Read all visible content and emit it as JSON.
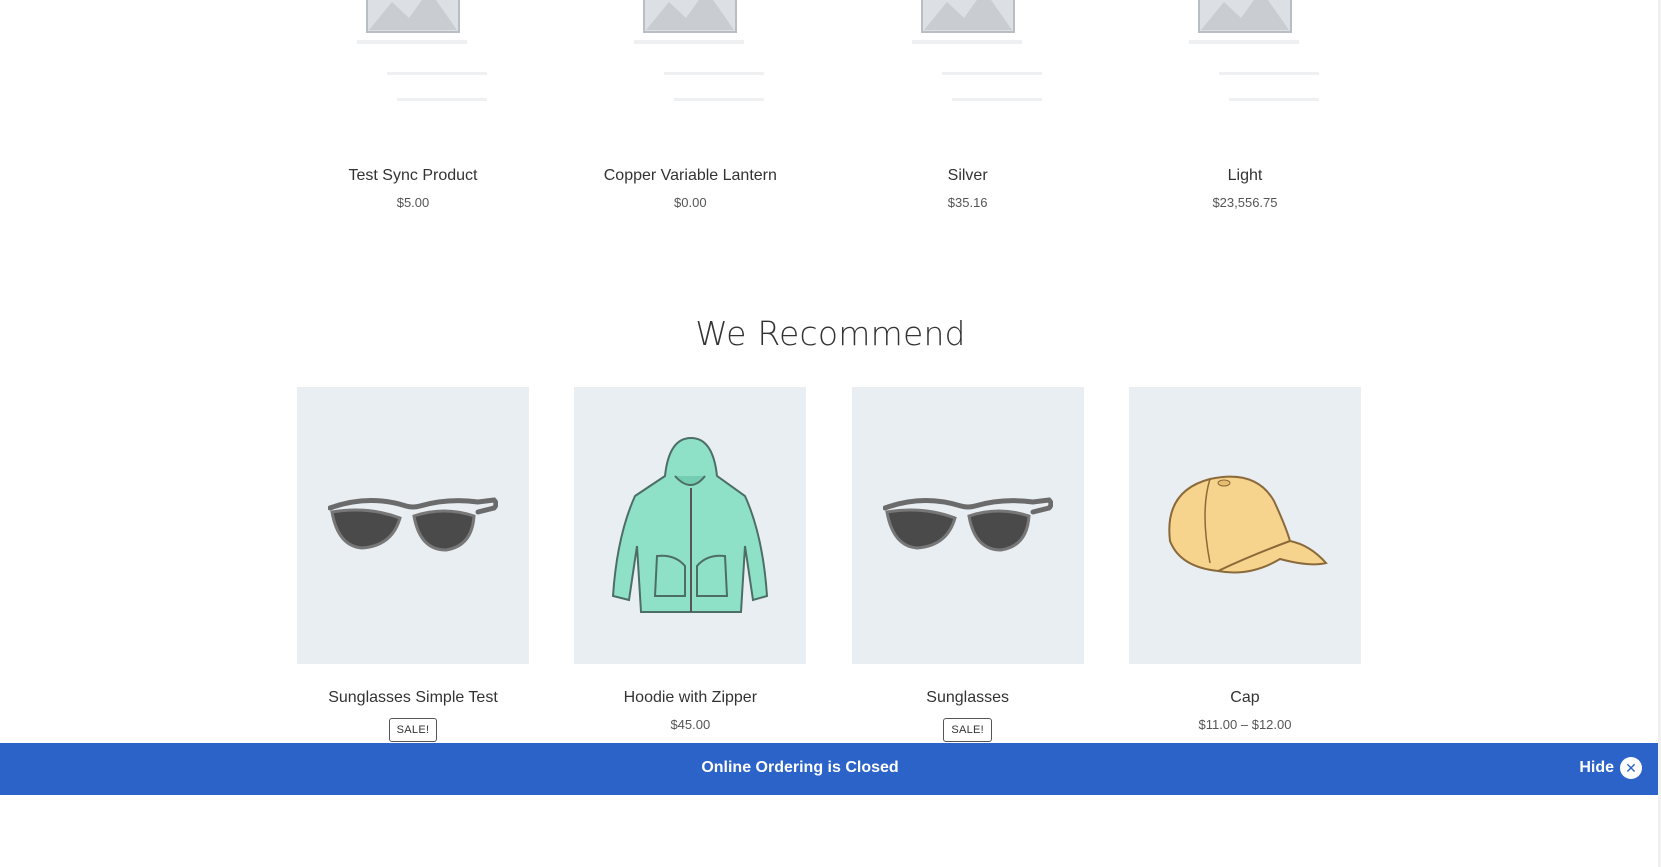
{
  "top_products": [
    {
      "title": "Test Sync Product",
      "price": "$5.00",
      "image": "placeholder-image"
    },
    {
      "title": "Copper Variable Lantern",
      "price": "$0.00",
      "image": "placeholder-image"
    },
    {
      "title": "Silver",
      "price": "$35.16",
      "image": "placeholder-image"
    },
    {
      "title": "Light",
      "price": "$23,556.75",
      "image": "placeholder-image"
    }
  ],
  "recommend": {
    "heading": "We Recommend",
    "products": [
      {
        "title": "Sunglasses Simple Test",
        "badge": "SALE!",
        "image": "sunglasses"
      },
      {
        "title": "Hoodie with Zipper",
        "price": "$45.00",
        "image": "hoodie"
      },
      {
        "title": "Sunglasses",
        "badge": "SALE!",
        "image": "sunglasses"
      },
      {
        "title": "Cap",
        "price": "$11.00 – $12.00",
        "image": "cap"
      }
    ]
  },
  "notice": {
    "message": "Online Ordering is Closed",
    "hide_label": "Hide",
    "icon": "close-circle-icon",
    "background": "#2c63c9"
  }
}
